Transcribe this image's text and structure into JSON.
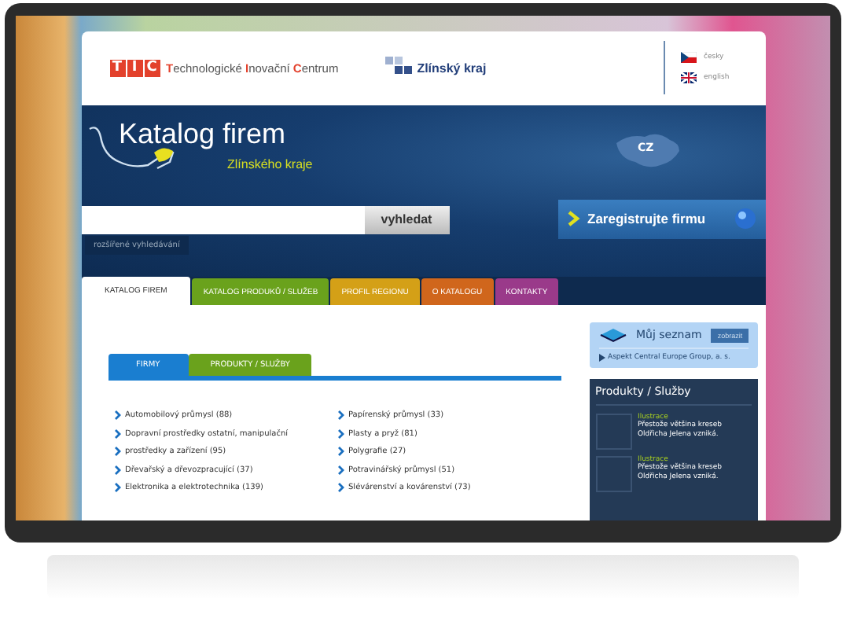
{
  "header": {
    "logo": [
      "T",
      "I",
      "C"
    ],
    "org_name": "**T**echnologické **I**novační **C**entrum",
    "region": "Zlínský kraj",
    "languages": [
      {
        "label": "česky",
        "kind": "cz"
      },
      {
        "label": "english",
        "kind": "en"
      }
    ]
  },
  "banner": {
    "title": "Katalog firem",
    "subtitle": "Zlínského kraje",
    "map_label": "CZ",
    "search": {
      "button": "vyhledat",
      "advanced_link": "rozšířené vyhledávání"
    },
    "register_button": "Zaregistrujte firmu"
  },
  "tabs": [
    {
      "label": "KATALOG FIREM",
      "selected": true
    },
    {
      "label": "KATALOG PRODUKŮ / SLUŽEB",
      "selected": false,
      "color": "#6aa21c"
    },
    {
      "label": "PROFIL REGIONU",
      "selected": false,
      "color": "#d4a017"
    },
    {
      "label": "O KATALOGU",
      "selected": false,
      "color": "#d0661c"
    },
    {
      "label": "KONTAKTY",
      "selected": false,
      "color": "#9a3a8a"
    }
  ],
  "subtabs": [
    {
      "label": "FIRMY",
      "selected": true
    },
    {
      "label": "PRODUKTY / SLUŽBY",
      "selected": false
    }
  ],
  "categories": [
    [
      "Automobilový průmysl (88)",
      "Dopravní prostředky ostatní, manipulační",
      "prostředky a zařízení (95)",
      "Dřevařský a dřevozpracující (37)",
      "Elektronika a elektrotechnika (139)"
    ],
    [
      "Papírenský průmysl (33)",
      "Plasty a pryž (81)",
      "Polygrafie (27)",
      "Potravinářský průmysl (51)",
      "Slévárenství a kovárenství (73)"
    ]
  ],
  "my_list": {
    "title": "Můj seznam",
    "button": "zobrazit",
    "items": [
      "Aspekt Central Europe Group, a. s."
    ]
  },
  "products": {
    "title": "Produkty / Služby",
    "items": [
      {
        "title": "Ilustrace",
        "text": "Přestože většina kreseb Oldřicha Jelena vzniká."
      },
      {
        "title": "Ilustrace",
        "text": "Přestože většina kreseb Oldřicha Jelena vzniká."
      }
    ]
  }
}
